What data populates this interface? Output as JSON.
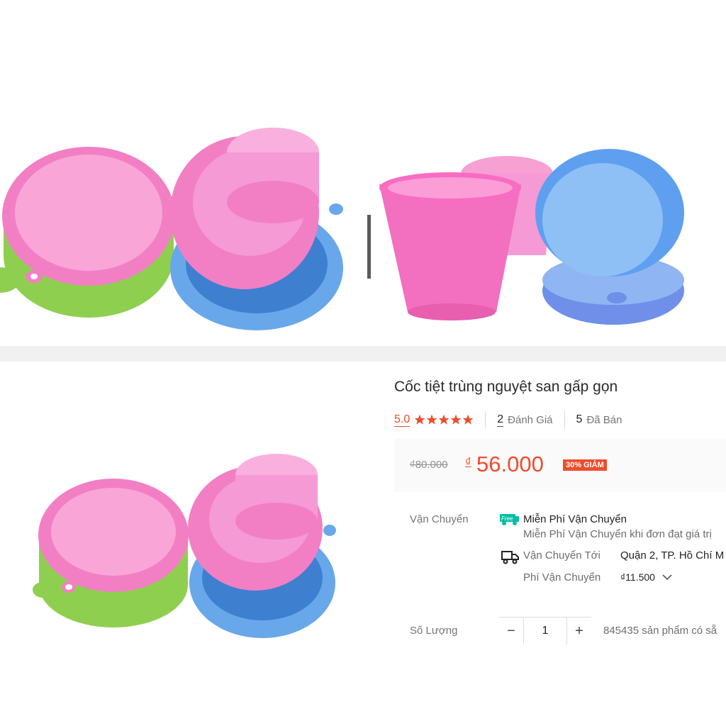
{
  "product": {
    "title": "Cốc tiệt trùng nguyệt san gấp gọn",
    "rating": "5.0",
    "star_count": 5,
    "review_count": "2",
    "review_label": "Đánh Giá",
    "sold_count": "5",
    "sold_label": "Đã Bán"
  },
  "price": {
    "old": "₫80.000",
    "currency_symbol": "₫",
    "current": "56.000",
    "discount_badge": "30% GIẢM"
  },
  "shipping": {
    "label": "Vận Chuyển",
    "free_icon_text": "Free",
    "free_title": "Miễn Phí Vận Chuyển",
    "free_desc": "Miễn Phí Vận Chuyển khi đơn đạt giá trị",
    "to_label": "Vận Chuyển Tới",
    "to_value": "Quận 2, TP. Hồ Chí M",
    "fee_label": "Phí Vận Chuyển",
    "fee_value": "₫11.500"
  },
  "quantity": {
    "label": "Số Lượng",
    "minus": "−",
    "value": "1",
    "plus": "+",
    "stock": "845435 sản phẩm có sẵ"
  },
  "colors": {
    "accent": "#ee4d2d",
    "pink": "#f78fc8",
    "blue": "#79aee8",
    "green": "#8fcf4f"
  },
  "icons": [
    "star-icon",
    "free-shipping-icon",
    "truck-icon",
    "chevron-down-icon",
    "minus-icon",
    "plus-icon"
  ]
}
